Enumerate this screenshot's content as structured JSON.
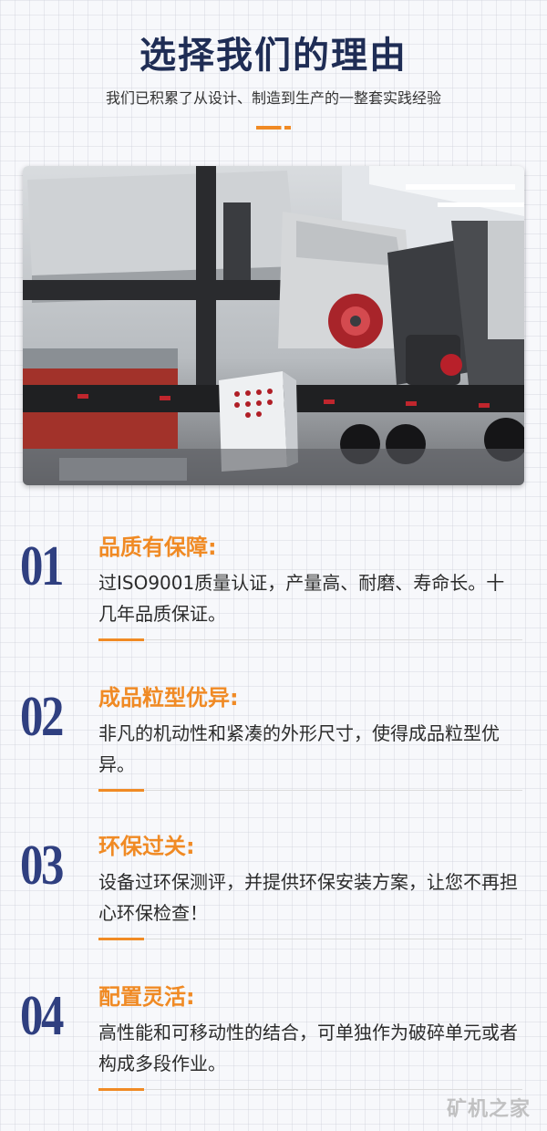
{
  "header": {
    "title": "选择我们的理由",
    "subtitle": "我们已积累了从设计、制造到生产的一整套实践经验"
  },
  "colors": {
    "navy": "#1f2d55",
    "number_blue": "#2f3f80",
    "accent_orange": "#f08a24"
  },
  "features": [
    {
      "number": "01",
      "title": "品质有保障:",
      "desc": "过ISO9001质量认证，产量高、耐磨、寿命长。十几年品质保证。"
    },
    {
      "number": "02",
      "title": "成品粒型优异:",
      "desc": "非凡的机动性和紧凑的外形尺寸，使得成品粒型优异。"
    },
    {
      "number": "03",
      "title": "环保过关:",
      "desc": "设备过环保测评，并提供环保安装方案，让您不再担心环保检查！"
    },
    {
      "number": "04",
      "title": "配置灵活:",
      "desc": "高性能和可移动性的结合，可单独作为破碎单元或者构成多段作业。"
    }
  ],
  "watermark": "矿机之家"
}
